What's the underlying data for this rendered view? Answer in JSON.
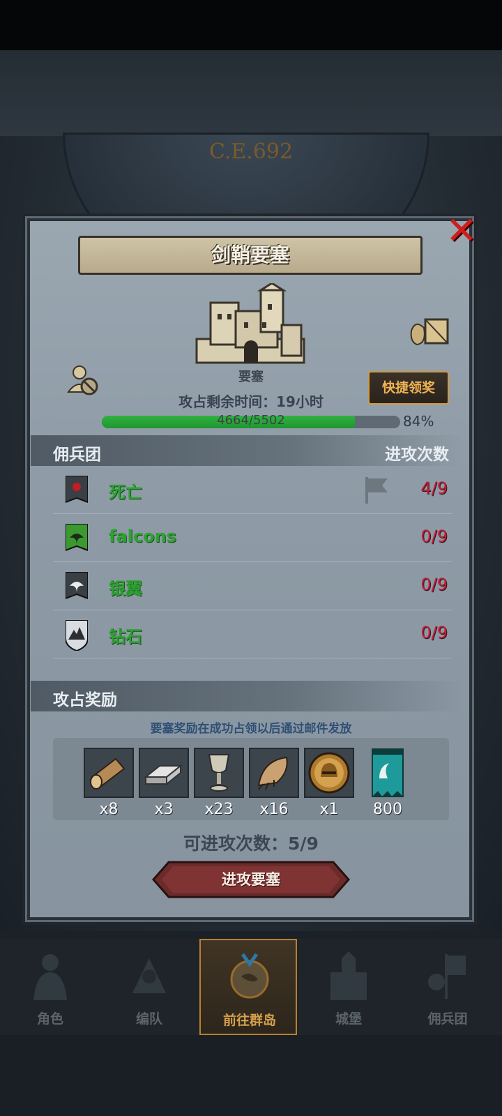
{
  "header": {
    "era": "C.E.692"
  },
  "dialog": {
    "title": "剑鞘要塞",
    "fortress_label": "要塞",
    "remaining_prefix": "攻占剩余时间：",
    "remaining_value": "19小时",
    "quick_claim": "快捷领奖",
    "progress": {
      "text": "4664/5502",
      "percent": "84%",
      "fraction": 0.848
    },
    "mercenary_section": {
      "title": "佣兵团",
      "right": "进攻次数"
    },
    "guilds": [
      {
        "name": "死亡",
        "count": "4/9",
        "banner": "red-emblem-banner-icon"
      },
      {
        "name": "falcons",
        "count": "0/9",
        "banner": "green-bird-banner-icon"
      },
      {
        "name": "银翼",
        "count": "0/9",
        "banner": "white-bird-banner-icon"
      },
      {
        "name": "钻石",
        "count": "0/9",
        "banner": "mountain-shield-icon"
      }
    ],
    "reward_section": {
      "title": "攻占奖励"
    },
    "reward_notice": "要塞奖励在成功占领以后通过邮件发放",
    "rewards": [
      {
        "icon": "wood-log-icon",
        "qty": "x8"
      },
      {
        "icon": "iron-ingot-icon",
        "qty": "x3"
      },
      {
        "icon": "goblet-icon",
        "qty": "x23"
      },
      {
        "icon": "fur-pelt-icon",
        "qty": "x16"
      },
      {
        "icon": "knight-helmet-coin-icon",
        "qty": "x1"
      },
      {
        "icon": "guild-banner-icon",
        "qty": "800"
      }
    ],
    "attempts_label": "可进攻次数：5/9",
    "attack_button": "进攻要塞"
  },
  "nav": {
    "items": [
      {
        "label": "角色",
        "icon": "character-icon"
      },
      {
        "label": "编队",
        "icon": "formation-icon"
      },
      {
        "label": "前往群岛",
        "icon": "islands-globe-icon"
      },
      {
        "label": "城堡",
        "icon": "castle-icon"
      },
      {
        "label": "佣兵团",
        "icon": "mercenary-icon"
      }
    ]
  },
  "colors": {
    "guild_name": "#2ea233",
    "attack_count": "#b8213a",
    "accent_gold": "#d7a14c"
  }
}
